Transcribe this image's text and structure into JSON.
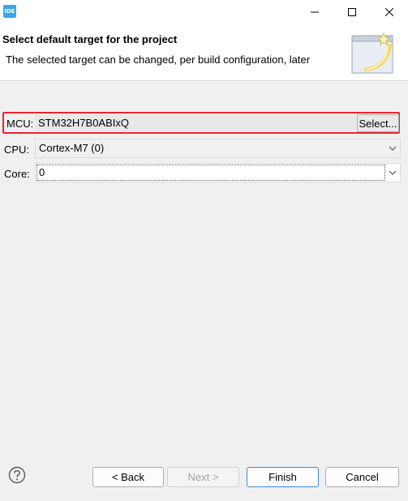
{
  "window": {
    "app_icon_text": "IDE",
    "minimize_icon": "minimize-icon",
    "maximize_icon": "maximize-icon",
    "close_icon": "close-icon"
  },
  "header": {
    "title": "Select default target for the project",
    "description": "The selected target can be changed, per build configuration, later",
    "art_icon": "wizard-banner-icon"
  },
  "form": {
    "mcu": {
      "label": "MCU:",
      "value": "STM32H7B0ABIxQ",
      "select_button": "Select..."
    },
    "cpu": {
      "label": "CPU:",
      "value": "Cortex-M7 (0)"
    },
    "core": {
      "label": "Core:",
      "value": "0"
    }
  },
  "buttons": {
    "back": "< Back",
    "next": "Next >",
    "finish": "Finish",
    "cancel": "Cancel"
  },
  "colors": {
    "highlight_border": "#e8262b",
    "accent": "#3b8ad9",
    "app_icon": "#39a8e0"
  }
}
